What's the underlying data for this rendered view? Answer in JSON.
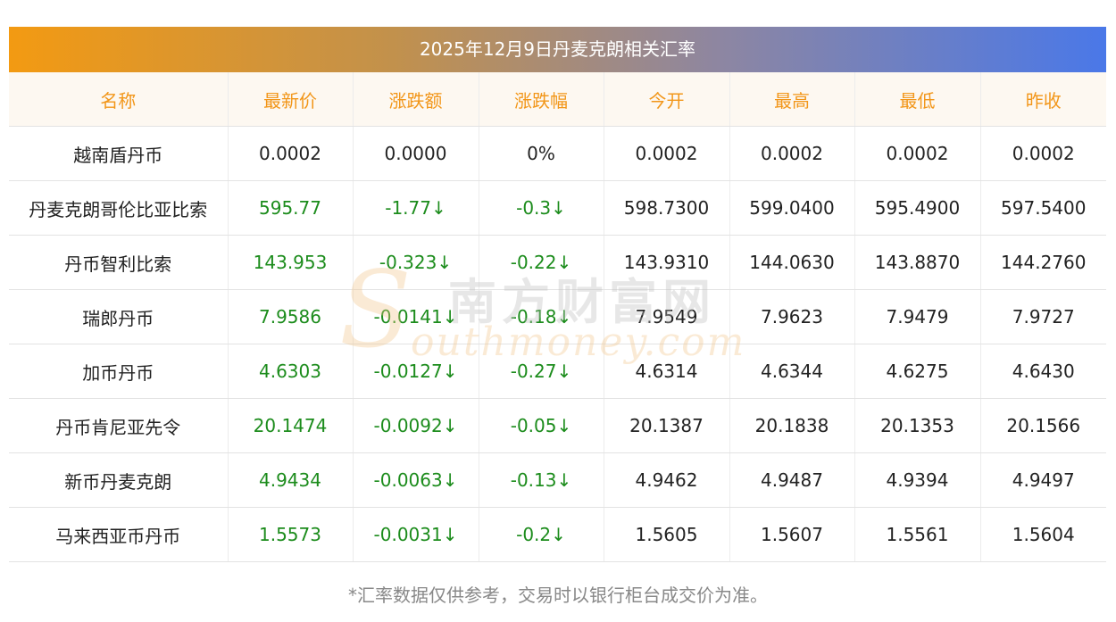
{
  "title": "2025年12月9日丹麦克朗相关汇率",
  "headers": [
    "名称",
    "最新价",
    "涨跌额",
    "涨跌幅",
    "今开",
    "最高",
    "最低",
    "昨收"
  ],
  "rows": [
    {
      "name": "越南盾丹币",
      "latest": "0.0002",
      "change": "0.0000",
      "change_pct": "0%",
      "open": "0.0002",
      "high": "0.0002",
      "low": "0.0002",
      "prev_close": "0.0002",
      "direction": "flat"
    },
    {
      "name": "丹麦克朗哥伦比亚比索",
      "latest": "595.77",
      "change": "-1.77↓",
      "change_pct": "-0.3↓",
      "open": "598.7300",
      "high": "599.0400",
      "low": "595.4900",
      "prev_close": "597.5400",
      "direction": "down"
    },
    {
      "name": "丹币智利比索",
      "latest": "143.953",
      "change": "-0.323↓",
      "change_pct": "-0.22↓",
      "open": "143.9310",
      "high": "144.0630",
      "low": "143.8870",
      "prev_close": "144.2760",
      "direction": "down"
    },
    {
      "name": "瑞郎丹币",
      "latest": "7.9586",
      "change": "-0.0141↓",
      "change_pct": "-0.18↓",
      "open": "7.9549",
      "high": "7.9623",
      "low": "7.9479",
      "prev_close": "7.9727",
      "direction": "down"
    },
    {
      "name": "加币丹币",
      "latest": "4.6303",
      "change": "-0.0127↓",
      "change_pct": "-0.27↓",
      "open": "4.6314",
      "high": "4.6344",
      "low": "4.6275",
      "prev_close": "4.6430",
      "direction": "down"
    },
    {
      "name": "丹币肯尼亚先令",
      "latest": "20.1474",
      "change": "-0.0092↓",
      "change_pct": "-0.05↓",
      "open": "20.1387",
      "high": "20.1838",
      "low": "20.1353",
      "prev_close": "20.1566",
      "direction": "down"
    },
    {
      "name": "新币丹麦克朗",
      "latest": "4.9434",
      "change": "-0.0063↓",
      "change_pct": "-0.13↓",
      "open": "4.9462",
      "high": "4.9487",
      "low": "4.9394",
      "prev_close": "4.9497",
      "direction": "down"
    },
    {
      "name": "马来西亚币丹币",
      "latest": "1.5573",
      "change": "-0.0031↓",
      "change_pct": "-0.2↓",
      "open": "1.5605",
      "high": "1.5607",
      "low": "1.5561",
      "prev_close": "1.5604",
      "direction": "down"
    }
  ],
  "watermark": {
    "logo_letter": "S",
    "cn": "南方财富网",
    "en": "outhmoney.com"
  },
  "footnote": "*汇率数据仅供参考，交易时以银行柜台成交价为准。",
  "colors": {
    "header_text": "#f29619",
    "header_bg": "#fdf8f1",
    "down": "#1c8c1c",
    "title_gradient_start": "#f39a12",
    "title_gradient_end": "#4a78e8"
  }
}
